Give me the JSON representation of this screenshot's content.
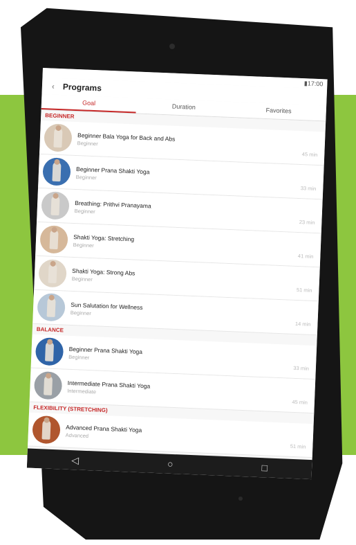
{
  "statusbar": {
    "time": "17:00"
  },
  "appbar": {
    "title": "Programs"
  },
  "tabs": [
    "Goal",
    "Duration",
    "Favorites"
  ],
  "sections": [
    {
      "name": "BEGINNER",
      "items": [
        {
          "title": "Beginner Bala Yoga for Back and Abs",
          "level": "Beginner",
          "duration": "45 min"
        },
        {
          "title": "Beginner Prana Shakti Yoga",
          "level": "Beginner",
          "duration": "33 min"
        },
        {
          "title": "Breathing: Prithvi Pranayama",
          "level": "Beginner",
          "duration": "23 min"
        },
        {
          "title": "Shakti Yoga: Stretching",
          "level": "Beginner",
          "duration": "41 min"
        },
        {
          "title": "Shakti Yoga: Strong Abs",
          "level": "Beginner",
          "duration": "51 min"
        },
        {
          "title": "Sun Salutation for Wellness",
          "level": "Beginner",
          "duration": "14 min"
        }
      ]
    },
    {
      "name": "BALANCE",
      "items": [
        {
          "title": "Beginner Prana Shakti Yoga",
          "level": "Beginner",
          "duration": "33 min"
        },
        {
          "title": "Intermediate Prana Shakti Yoga",
          "level": "Intermediate",
          "duration": "45 min"
        }
      ]
    },
    {
      "name": "FLEXIBILITY (STRETCHING)",
      "items": [
        {
          "title": "Advanced Prana Shakti Yoga",
          "level": "Advanced",
          "duration": "51 min"
        }
      ]
    }
  ],
  "navbar": {
    "back_icon": "◁",
    "home_icon": "○",
    "recents_icon": "□"
  },
  "colors": {
    "accent": "#c62828",
    "background": "#8dc63f"
  }
}
